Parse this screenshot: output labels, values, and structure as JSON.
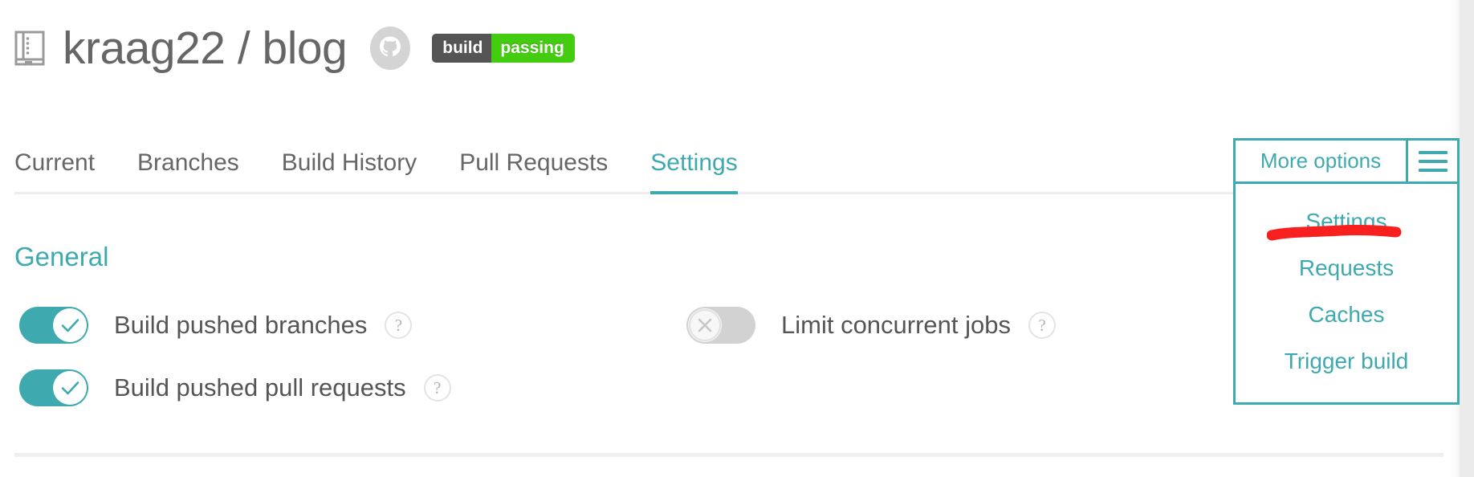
{
  "header": {
    "repo_icon": "repository-book-icon",
    "title": "kraag22 / blog",
    "github_icon": "github-octocat-icon",
    "build_badge": {
      "left_label": "build",
      "right_label": "passing",
      "left_color": "#555555",
      "right_color": "#44cc11"
    }
  },
  "tabs": [
    {
      "label": "Current",
      "active": false
    },
    {
      "label": "Branches",
      "active": false
    },
    {
      "label": "Build History",
      "active": false
    },
    {
      "label": "Pull Requests",
      "active": false
    },
    {
      "label": "Settings",
      "active": true
    }
  ],
  "main": {
    "section_title": "General",
    "settings": [
      {
        "label": "Build pushed branches",
        "state": "on",
        "knob_icon": "check-icon",
        "help_icon": "question-mark-icon",
        "help_glyph": "?"
      },
      {
        "label": "Build pushed pull requests",
        "state": "on",
        "knob_icon": "check-icon",
        "help_icon": "question-mark-icon",
        "help_glyph": "?"
      },
      {
        "label": "Limit concurrent jobs",
        "state": "off",
        "knob_icon": "close-x-icon",
        "help_icon": "question-mark-icon",
        "help_glyph": "?"
      }
    ]
  },
  "more_options": {
    "button_label": "More options",
    "menu_icon": "hamburger-menu-icon",
    "items": [
      {
        "label": "Settings"
      },
      {
        "label": "Requests"
      },
      {
        "label": "Caches"
      },
      {
        "label": "Trigger build"
      }
    ]
  },
  "annotation": {
    "type": "red-highlight-stroke",
    "target": "Settings",
    "color": "#f81f1f"
  },
  "colors": {
    "accent_teal": "#3eaaaf",
    "text_gray": "#666666",
    "label_gray": "#555555",
    "rule_gray": "#eeeeee",
    "toggle_off_gray": "#d2d2d2",
    "badge_green": "#44cc11",
    "badge_dark": "#555555",
    "annotation_red": "#f81f1f"
  }
}
